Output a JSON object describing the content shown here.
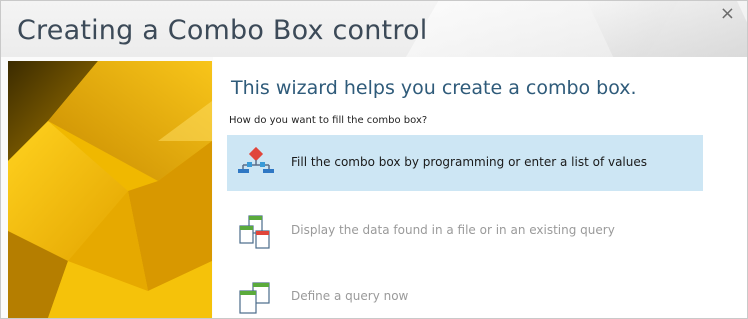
{
  "window": {
    "title": "Creating a Combo Box control",
    "close_glyph": "×"
  },
  "wizard": {
    "heading": "This wizard helps you create a combo box.",
    "question": "How do you want to fill the combo box?",
    "options": [
      {
        "label": "Fill the combo box by programming or enter a list of values",
        "icon": "hierarchy-icon",
        "selected": true
      },
      {
        "label": "Display the data found in a file or in an existing query",
        "icon": "file-query-icon",
        "selected": false
      },
      {
        "label": "Define a query now",
        "icon": "define-query-icon",
        "selected": false
      }
    ]
  },
  "colors": {
    "selected_option_bg": "#cde6f4",
    "heading_color": "#2f5b7a",
    "side_image_yellow": "#f3bc00"
  }
}
